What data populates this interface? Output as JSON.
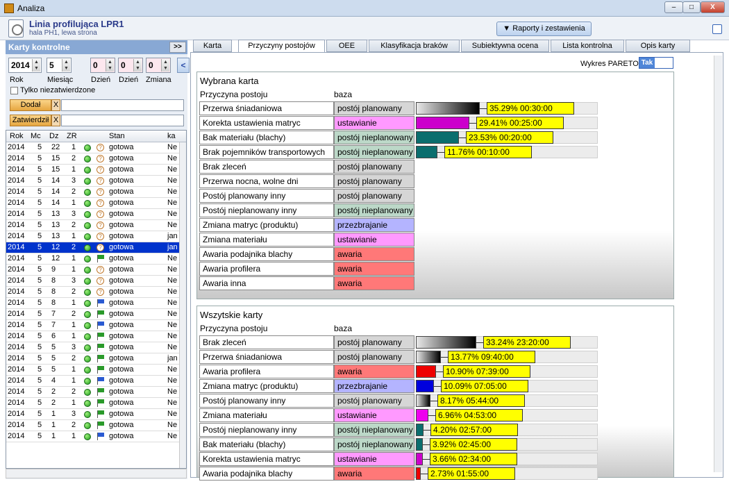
{
  "window": {
    "title": "Analiza",
    "minimize": "–",
    "maximize": "□",
    "close": "X"
  },
  "header": {
    "line": "Linia profilująca LPR1",
    "location": "hala PH1, lewa strona",
    "reports_button": "Raporty i zestawienia"
  },
  "left": {
    "title": "Karty kontrolne",
    "expand": ">>",
    "year": "2014",
    "month": "5",
    "day_from": "0",
    "day_to": "0",
    "shift": "0",
    "labels": {
      "year": "Rok",
      "month": "Miesiąc",
      "day1": "Dzień",
      "day2": "Dzień",
      "shift": "Zmiana"
    },
    "back": "<",
    "only_unapproved": "Tylko niezatwierdzone",
    "added_btn": "Dodał",
    "approved_btn": "Zatwierdził",
    "x": "X",
    "columns": [
      "Rok",
      "Mc",
      "Dz",
      "ZR",
      "",
      "",
      "Stan",
      "ka"
    ],
    "rows": [
      {
        "rok": "2014",
        "mc": "5",
        "dz": "22",
        "zr": "1",
        "flag": "q",
        "stan": "gotowa",
        "ka": "Ne"
      },
      {
        "rok": "2014",
        "mc": "5",
        "dz": "15",
        "zr": "2",
        "flag": "q",
        "stan": "gotowa",
        "ka": "Ne"
      },
      {
        "rok": "2014",
        "mc": "5",
        "dz": "15",
        "zr": "1",
        "flag": "q",
        "stan": "gotowa",
        "ka": "Ne"
      },
      {
        "rok": "2014",
        "mc": "5",
        "dz": "14",
        "zr": "3",
        "flag": "q",
        "stan": "gotowa",
        "ka": "Ne"
      },
      {
        "rok": "2014",
        "mc": "5",
        "dz": "14",
        "zr": "2",
        "flag": "q",
        "stan": "gotowa",
        "ka": "Ne"
      },
      {
        "rok": "2014",
        "mc": "5",
        "dz": "14",
        "zr": "1",
        "flag": "q",
        "stan": "gotowa",
        "ka": "Ne"
      },
      {
        "rok": "2014",
        "mc": "5",
        "dz": "13",
        "zr": "3",
        "flag": "q",
        "stan": "gotowa",
        "ka": "Ne"
      },
      {
        "rok": "2014",
        "mc": "5",
        "dz": "13",
        "zr": "2",
        "flag": "q",
        "stan": "gotowa",
        "ka": "Ne"
      },
      {
        "rok": "2014",
        "mc": "5",
        "dz": "13",
        "zr": "1",
        "flag": "q",
        "stan": "gotowa",
        "ka": "jan"
      },
      {
        "rok": "2014",
        "mc": "5",
        "dz": "12",
        "zr": "2",
        "flag": "q",
        "stan": "gotowa",
        "ka": "jan",
        "selected": true
      },
      {
        "rok": "2014",
        "mc": "5",
        "dz": "12",
        "zr": "1",
        "flag": "green",
        "stan": "gotowa",
        "ka": "Ne"
      },
      {
        "rok": "2014",
        "mc": "5",
        "dz": "9",
        "zr": "1",
        "flag": "q",
        "stan": "gotowa",
        "ka": "Ne"
      },
      {
        "rok": "2014",
        "mc": "5",
        "dz": "8",
        "zr": "3",
        "flag": "q",
        "stan": "gotowa",
        "ka": "Ne"
      },
      {
        "rok": "2014",
        "mc": "5",
        "dz": "8",
        "zr": "2",
        "flag": "q",
        "stan": "gotowa",
        "ka": "Ne"
      },
      {
        "rok": "2014",
        "mc": "5",
        "dz": "8",
        "zr": "1",
        "flag": "blue",
        "stan": "gotowa",
        "ka": "Ne"
      },
      {
        "rok": "2014",
        "mc": "5",
        "dz": "7",
        "zr": "2",
        "flag": "green",
        "stan": "gotowa",
        "ka": "Ne"
      },
      {
        "rok": "2014",
        "mc": "5",
        "dz": "7",
        "zr": "1",
        "flag": "blue",
        "stan": "gotowa",
        "ka": "Ne"
      },
      {
        "rok": "2014",
        "mc": "5",
        "dz": "6",
        "zr": "1",
        "flag": "green",
        "stan": "gotowa",
        "ka": "Ne"
      },
      {
        "rok": "2014",
        "mc": "5",
        "dz": "5",
        "zr": "3",
        "flag": "green",
        "stan": "gotowa",
        "ka": "Ne"
      },
      {
        "rok": "2014",
        "mc": "5",
        "dz": "5",
        "zr": "2",
        "flag": "green",
        "stan": "gotowa",
        "ka": "jan"
      },
      {
        "rok": "2014",
        "mc": "5",
        "dz": "5",
        "zr": "1",
        "flag": "green",
        "stan": "gotowa",
        "ka": "Ne"
      },
      {
        "rok": "2014",
        "mc": "5",
        "dz": "4",
        "zr": "1",
        "flag": "blue",
        "stan": "gotowa",
        "ka": "Ne"
      },
      {
        "rok": "2014",
        "mc": "5",
        "dz": "2",
        "zr": "2",
        "flag": "green",
        "stan": "gotowa",
        "ka": "Ne"
      },
      {
        "rok": "2014",
        "mc": "5",
        "dz": "2",
        "zr": "1",
        "flag": "green",
        "stan": "gotowa",
        "ka": "Ne"
      },
      {
        "rok": "2014",
        "mc": "5",
        "dz": "1",
        "zr": "3",
        "flag": "green",
        "stan": "gotowa",
        "ka": "Ne"
      },
      {
        "rok": "2014",
        "mc": "5",
        "dz": "1",
        "zr": "2",
        "flag": "green",
        "stan": "gotowa",
        "ka": "Ne"
      },
      {
        "rok": "2014",
        "mc": "5",
        "dz": "1",
        "zr": "1",
        "flag": "blue",
        "stan": "gotowa",
        "ka": "Ne"
      }
    ]
  },
  "tabs": [
    "Karta",
    "Przyczyny postojów",
    "OEE",
    "Klasyfikacja braków",
    "Subiektywna ocena",
    "Lista kontrolna",
    "Opis karty"
  ],
  "active_tab": 1,
  "pareto": {
    "label": "Wykres PARETO",
    "toggle": "Tak"
  },
  "colors": {
    "postoj planowany": "#d6d6d6",
    "ustawianie": "#ff99ff",
    "postoj nieplanowany": "#bcd8c8",
    "przezbrajanie": "#b4b4ff",
    "awaria": "#ff7878"
  },
  "chart_data": [
    {
      "type": "bar",
      "title": "Wybrana karta",
      "xlabel": "",
      "ylabel": "Przyczyna postoju",
      "category_header": "baza",
      "rows": [
        {
          "name": "Przerwa śniadaniowa",
          "cat": "postój planowany",
          "catkey": "postoj planowany",
          "value": 35.29,
          "time": "00:30:00",
          "bar": "black"
        },
        {
          "name": "Korekta ustawienia matryc",
          "cat": "ustawianie",
          "catkey": "ustawianie",
          "value": 29.41,
          "time": "00:25:00",
          "bar": "#cc00cc"
        },
        {
          "name": "Bak materiału (blachy)",
          "cat": "postój nieplanowany",
          "catkey": "postoj nieplanowany",
          "value": 23.53,
          "time": "00:20:00",
          "bar": "#0a6e6e"
        },
        {
          "name": "Brak pojemników transportowych",
          "cat": "postój nieplanowany",
          "catkey": "postoj nieplanowany",
          "value": 11.76,
          "time": "00:10:00",
          "bar": "#0a6e6e"
        },
        {
          "name": "Brak zleceń",
          "cat": "postój planowany",
          "catkey": "postoj planowany",
          "value": null,
          "time": ""
        },
        {
          "name": "Przerwa nocna, wolne dni",
          "cat": "postój planowany",
          "catkey": "postoj planowany",
          "value": null,
          "time": ""
        },
        {
          "name": "Postój planowany inny",
          "cat": "postój planowany",
          "catkey": "postoj planowany",
          "value": null,
          "time": ""
        },
        {
          "name": "Postój nieplanowany inny",
          "cat": "postój nieplanowany",
          "catkey": "postoj nieplanowany",
          "value": null,
          "time": ""
        },
        {
          "name": "Zmiana matryc (produktu)",
          "cat": "przezbrajanie",
          "catkey": "przezbrajanie",
          "value": null,
          "time": ""
        },
        {
          "name": "Zmiana materiału",
          "cat": "ustawianie",
          "catkey": "ustawianie",
          "value": null,
          "time": ""
        },
        {
          "name": "Awaria podajnika blachy",
          "cat": "awaria",
          "catkey": "awaria",
          "value": null,
          "time": ""
        },
        {
          "name": "Awaria profilera",
          "cat": "awaria",
          "catkey": "awaria",
          "value": null,
          "time": ""
        },
        {
          "name": "Awaria inna",
          "cat": "awaria",
          "catkey": "awaria",
          "value": null,
          "time": ""
        }
      ]
    },
    {
      "type": "bar",
      "title": "Wszytskie karty",
      "xlabel": "",
      "ylabel": "Przyczyna postoju",
      "category_header": "baza",
      "rows": [
        {
          "name": "Brak zleceń",
          "cat": "postój planowany",
          "catkey": "postoj planowany",
          "value": 33.24,
          "time": "23:20:00",
          "bar": "black"
        },
        {
          "name": "Przerwa śniadaniowa",
          "cat": "postój planowany",
          "catkey": "postoj planowany",
          "value": 13.77,
          "time": "09:40:00",
          "bar": "black"
        },
        {
          "name": "Awaria profilera",
          "cat": "awaria",
          "catkey": "awaria",
          "value": 10.9,
          "time": "07:39:00",
          "bar": "#ee0000"
        },
        {
          "name": "Zmiana matryc (produktu)",
          "cat": "przezbrajanie",
          "catkey": "przezbrajanie",
          "value": 10.09,
          "time": "07:05:00",
          "bar": "#0000dd"
        },
        {
          "name": "Postój planowany inny",
          "cat": "postój planowany",
          "catkey": "postoj planowany",
          "value": 8.17,
          "time": "05:44:00",
          "bar": "black"
        },
        {
          "name": "Zmiana materiału",
          "cat": "ustawianie",
          "catkey": "ustawianie",
          "value": 6.96,
          "time": "04:53:00",
          "bar": "#ee00ee"
        },
        {
          "name": "Postój nieplanowany inny",
          "cat": "postój nieplanowany",
          "catkey": "postoj nieplanowany",
          "value": 4.2,
          "time": "02:57:00",
          "bar": "#0a6e6e"
        },
        {
          "name": "Bak materiału (blachy)",
          "cat": "postój nieplanowany",
          "catkey": "postoj nieplanowany",
          "value": 3.92,
          "time": "02:45:00",
          "bar": "#0a6e6e"
        },
        {
          "name": "Korekta ustawienia matryc",
          "cat": "ustawianie",
          "catkey": "ustawianie",
          "value": 3.66,
          "time": "02:34:00",
          "bar": "#cc00cc"
        },
        {
          "name": "Awaria podajnika blachy",
          "cat": "awaria",
          "catkey": "awaria",
          "value": 2.73,
          "time": "01:55:00",
          "bar": "#ee0000"
        }
      ]
    }
  ]
}
